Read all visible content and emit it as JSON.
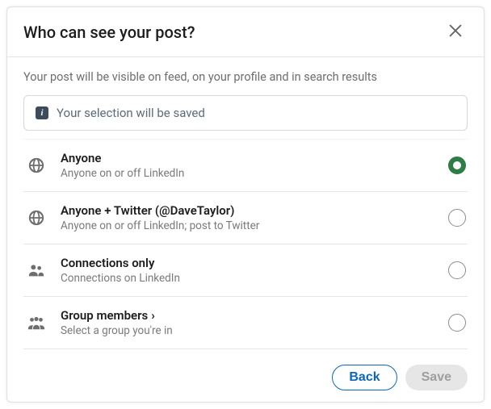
{
  "header": {
    "title": "Who can see your post?"
  },
  "subtitle": "Your post will be visible on feed, on your profile and in search results",
  "notice": "Your selection will be saved",
  "options": [
    {
      "icon": "globe-icon",
      "title": "Anyone",
      "desc": "Anyone on or off LinkedIn",
      "selected": true,
      "chevron": false
    },
    {
      "icon": "globe-icon",
      "title": "Anyone + Twitter (@DaveTaylor)",
      "desc": "Anyone on or off LinkedIn; post to Twitter",
      "selected": false,
      "chevron": false
    },
    {
      "icon": "people-icon",
      "title": "Connections only",
      "desc": "Connections on LinkedIn",
      "selected": false,
      "chevron": false
    },
    {
      "icon": "group-icon",
      "title": "Group members",
      "desc": "Select a group you're in",
      "selected": false,
      "chevron": true
    }
  ],
  "footer": {
    "back": "Back",
    "save": "Save"
  }
}
